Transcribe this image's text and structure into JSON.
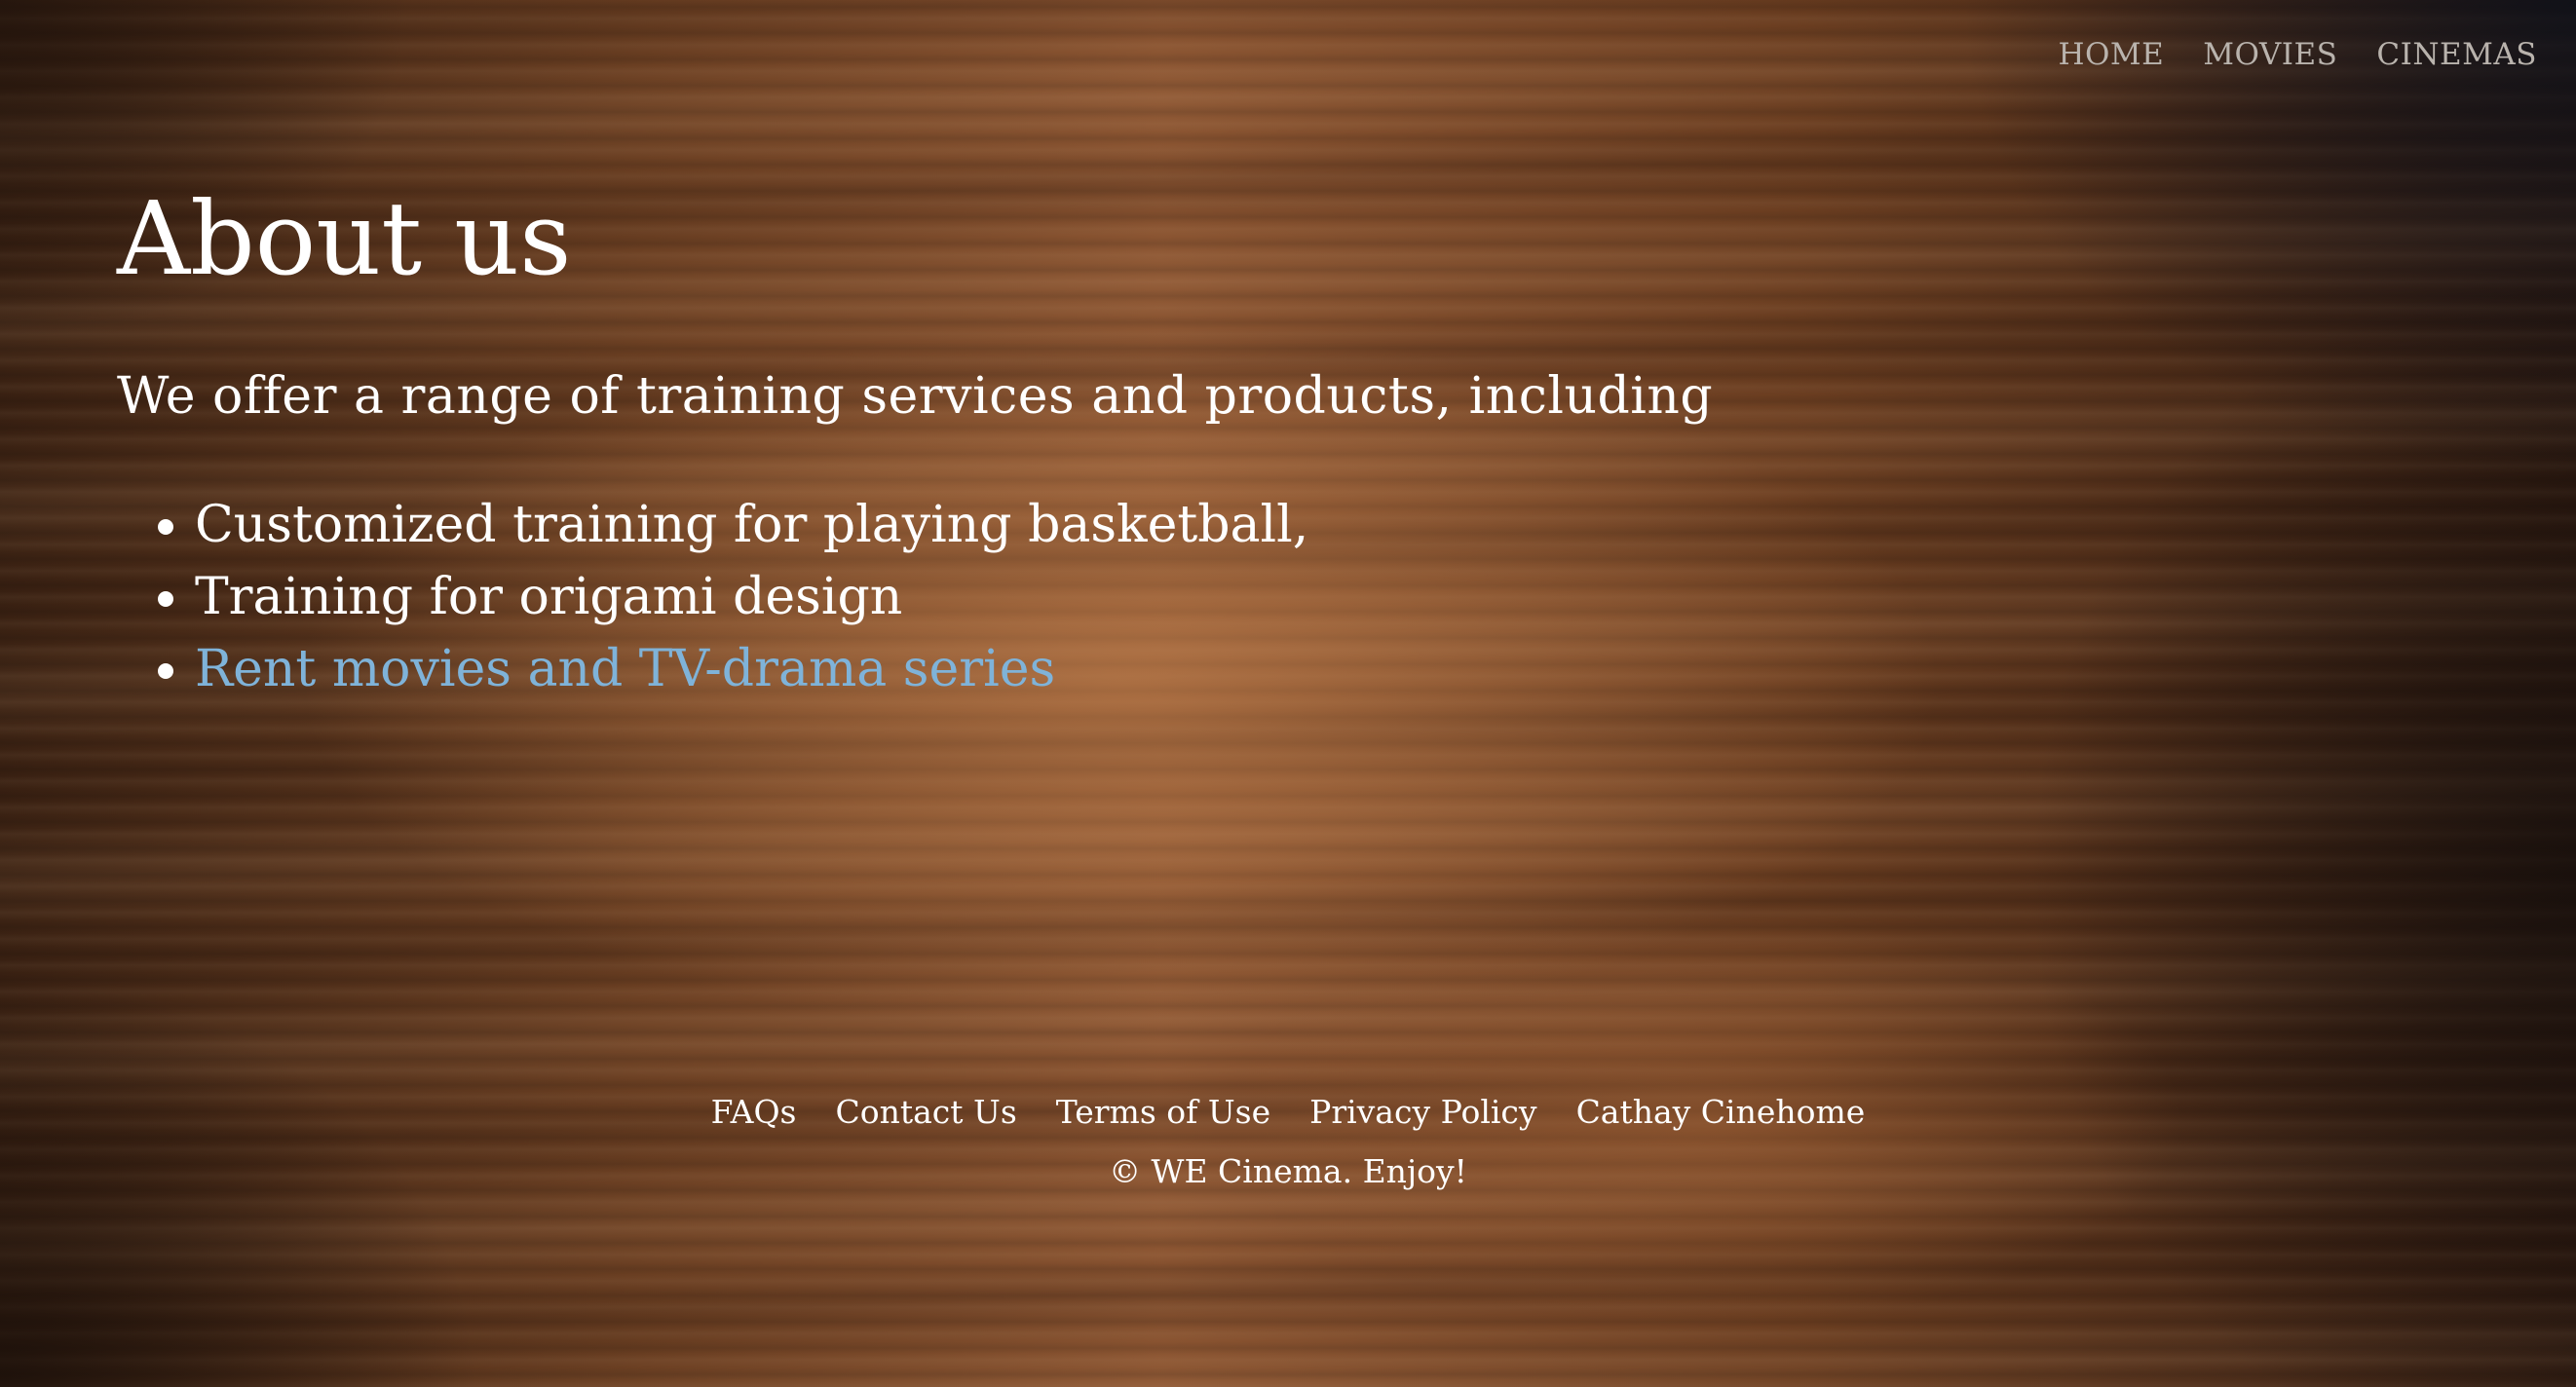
{
  "nav": {
    "items": [
      {
        "label": "HOME"
      },
      {
        "label": "MOVIES"
      },
      {
        "label": "CINEMAS"
      }
    ]
  },
  "main": {
    "title": "About us",
    "intro": "We offer a range of training services and products, including",
    "services": [
      {
        "text": "Customized training for playing basketball,"
      },
      {
        "text": "Training for origami design"
      },
      {
        "text": "Rent movies and TV-drama series"
      }
    ]
  },
  "footer": {
    "links": [
      {
        "label": "FAQs"
      },
      {
        "label": "Contact Us"
      },
      {
        "label": "Terms of Use"
      },
      {
        "label": "Privacy Policy"
      },
      {
        "label": "Cathay Cinehome"
      }
    ],
    "copyright": "© WE Cinema. Enjoy!"
  },
  "colors": {
    "nav_text": "#b9b3ad",
    "link_blue": "#7fb3d9",
    "text": "#ffffff"
  }
}
